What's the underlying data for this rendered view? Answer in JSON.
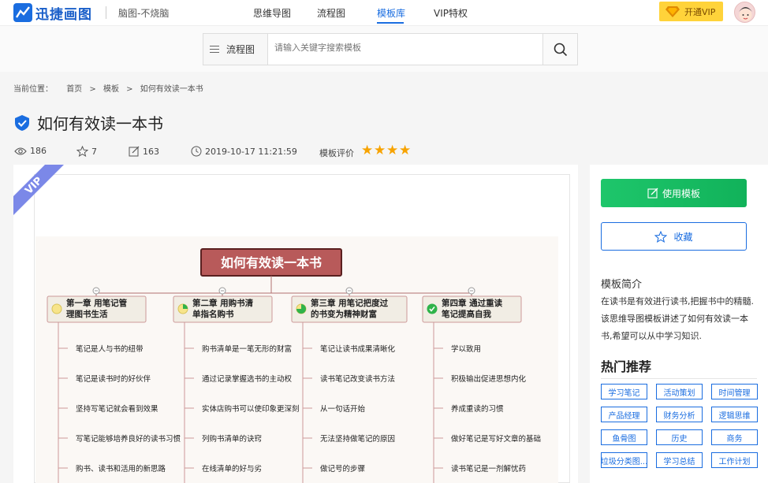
{
  "header": {
    "logo_text": "迅捷画图",
    "slogan": "脑图-不烧脑",
    "nav": [
      "思维导图",
      "流程图",
      "模板库",
      "VIP特权"
    ],
    "active_nav": "模板库",
    "vip_button": "开通VIP"
  },
  "search": {
    "category": "流程图",
    "placeholder": "请输入关键字搜索模板"
  },
  "breadcrumb": {
    "label": "当前位置：",
    "items": [
      "首页",
      ">",
      "模板",
      ">",
      "如何有效读一本书"
    ]
  },
  "template": {
    "title": "如何有效读一本书",
    "views": "186",
    "likes": "7",
    "edits": "163",
    "datetime": "2019-10-17 11:21:59",
    "rating_label": "模板评价",
    "rating": 4
  },
  "preview": {
    "vip_badge": "VIP",
    "root": "如何有效读一本书",
    "chapters": [
      {
        "title": "第一章 用笔记管\n理图书生活",
        "progress": 0,
        "items": [
          "笔记是人与书的纽带",
          "笔记是读书时的好伙伴",
          "坚持写笔记就会看到效果",
          "写笔记能够培养良好的读书习惯",
          "购书、读书和活用的新思路"
        ]
      },
      {
        "title": "第二章 用购书清\n单指名购书",
        "progress": 0.25,
        "items": [
          "购书清单是一笔无形的财富",
          "通过记录掌握选书的主动权",
          "实体店购书可以使印象更深刻",
          "列购书清单的诀窍",
          "在线清单的好与劣"
        ]
      },
      {
        "title": "第三章 用笔记把度过\n的书变为精神财富",
        "progress": 0.75,
        "items": [
          "笔记让读书成果清晰化",
          "读书笔记改变读书方法",
          "从一句话开始",
          "无法坚持做笔记的原因",
          "做记号的步骤"
        ]
      },
      {
        "title": "第四章 通过重读\n笔记提高自我",
        "progress": 1,
        "items": [
          "学以致用",
          "积极输出促进思想内化",
          "养成重读的习惯",
          "做好笔记是写好文章的基础",
          "读书笔记是一剂解忧药"
        ]
      }
    ]
  },
  "sidebar": {
    "use_button": "使用模板",
    "fav_button": "收藏",
    "intro_head": "模板简介",
    "intro_text": "在读书是有效进行读书,把握书中的精髓.该思维导图模板讲述了如何有效读一本书,希望可以从中学习知识.",
    "hot_head": "热门推荐",
    "tags": [
      "学习笔记",
      "活动策划",
      "时间管理",
      "产品经理",
      "财务分析",
      "逻辑思维",
      "鱼骨图",
      "历史",
      "商务",
      "垃圾分类图...",
      "学习总结",
      "工作计划"
    ]
  },
  "colors": {
    "brand": "#1a6de0",
    "green": "#1ec66b",
    "star": "#f7a300",
    "root_fill": "#b85a5a"
  }
}
